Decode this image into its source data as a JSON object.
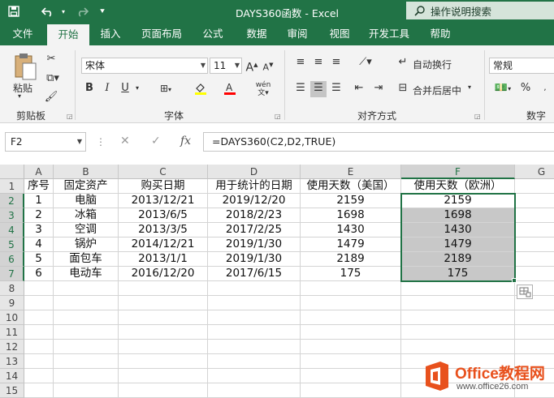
{
  "window": {
    "title": "DAYS360函数  -  Excel",
    "tell_me": "操作说明搜索"
  },
  "ribbon": {
    "tabs": [
      "文件",
      "开始",
      "插入",
      "页面布局",
      "公式",
      "数据",
      "审阅",
      "视图",
      "开发工具",
      "帮助"
    ],
    "active_tab": "开始",
    "clipboard": {
      "paste_label": "粘贴",
      "group_label": "剪贴板"
    },
    "font": {
      "name": "宋体",
      "size": "11",
      "group_label": "字体",
      "bold": "B",
      "italic": "I",
      "underline": "U",
      "grow": "A",
      "shrink": "A",
      "phonetic": "wén"
    },
    "alignment": {
      "wrap_text": "自动换行",
      "merge_center": "合并后居中",
      "group_label": "对齐方式"
    },
    "number": {
      "format": "常规",
      "group_label": "数字",
      "percent": "%"
    }
  },
  "formula_bar": {
    "name_box": "F2",
    "cancel_icon": "✕",
    "enter_icon": "✓",
    "fx_label": "fx",
    "formula": "=DAYS360(C2,D2,TRUE)"
  },
  "sheet": {
    "columns": [
      "A",
      "B",
      "C",
      "D",
      "E",
      "F",
      "G"
    ],
    "selected_column": "F",
    "selected_rows": [
      "2",
      "3",
      "4",
      "5",
      "6",
      "7"
    ],
    "row_numbers": [
      "1",
      "2",
      "3",
      "4",
      "5",
      "6",
      "7",
      "8",
      "9",
      "10",
      "11",
      "12",
      "13",
      "14",
      "15"
    ],
    "headers": [
      "序号",
      "固定资产",
      "购买日期",
      "用于统计的日期",
      "使用天数（美国）",
      "使用天数（欧洲）"
    ],
    "rows": [
      [
        "1",
        "电脑",
        "2013/12/21",
        "2019/12/20",
        "2159",
        "2159"
      ],
      [
        "2",
        "冰箱",
        "2013/6/5",
        "2018/2/23",
        "1698",
        "1698"
      ],
      [
        "3",
        "空调",
        "2013/3/5",
        "2017/2/25",
        "1430",
        "1430"
      ],
      [
        "4",
        "锅炉",
        "2014/12/21",
        "2019/1/30",
        "1479",
        "1479"
      ],
      [
        "5",
        "面包车",
        "2013/1/1",
        "2019/1/30",
        "2189",
        "2189"
      ],
      [
        "6",
        "电动车",
        "2016/12/20",
        "2017/6/15",
        "175",
        "175"
      ]
    ]
  },
  "watermark": {
    "name": "Office教程网",
    "url": "www.office26.com"
  },
  "colors": {
    "accent": "#217346",
    "selection_fill": "#c8c8c8",
    "watermark": "#e8511d"
  }
}
